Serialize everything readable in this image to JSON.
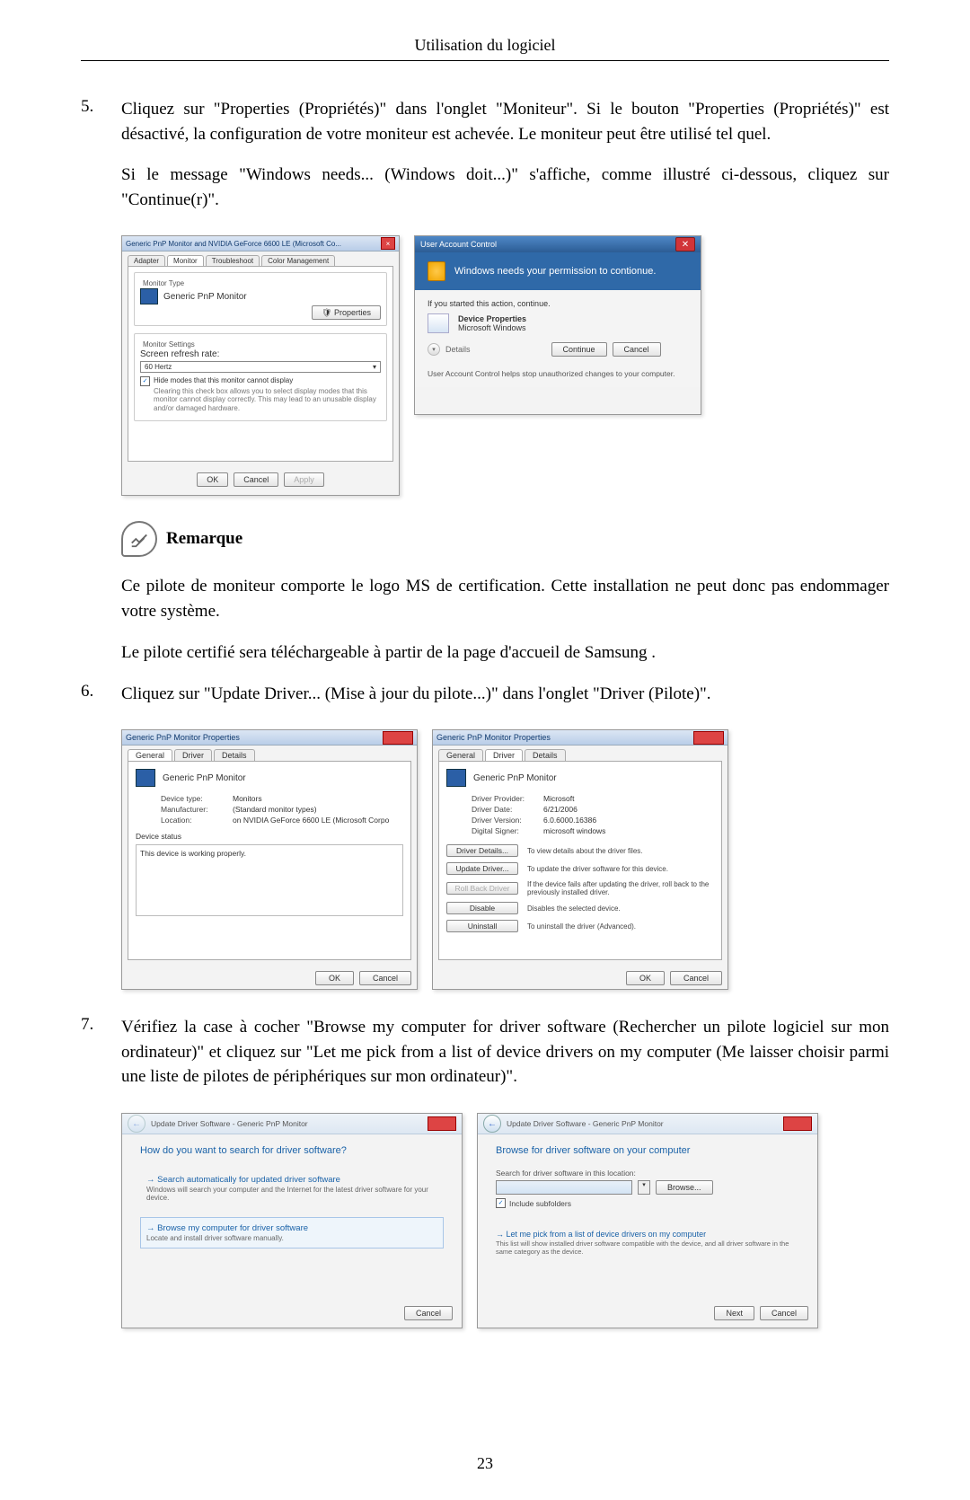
{
  "header": "Utilisation du logiciel",
  "page_number": "23",
  "steps": {
    "s5": {
      "num": "5.",
      "p1": "Cliquez sur \"Properties (Propriétés)\" dans l'onglet \"Moniteur\". Si le bouton \"Properties (Propriétés)\" est désactivé, la configuration de votre moniteur est achevée. Le moniteur peut être utilisé tel quel.",
      "p2": "Si le message \"Windows needs... (Windows doit...)\" s'affiche, comme illustré ci-dessous, cliquez sur \"Continue(r)\"."
    },
    "s6": {
      "num": "6.",
      "p1": "Cliquez sur \"Update Driver... (Mise à jour du pilote...)\" dans l'onglet \"Driver (Pilote)\"."
    },
    "s7": {
      "num": "7.",
      "p1": "Vérifiez la case à cocher \"Browse my computer for driver software (Rechercher un pilote logiciel sur mon ordinateur)\" et cliquez sur \"Let me pick from a list of device drivers on my computer (Me laisser choisir parmi une liste de pilotes de périphériques sur mon ordinateur)\"."
    }
  },
  "remarque": {
    "label": "Remarque",
    "p1": "Ce pilote de moniteur comporte le logo MS de certification. Cette installation ne peut donc pas endommager votre système.",
    "p2": "Le pilote certifié sera téléchargeable à partir de la page d'accueil de Samsung ."
  },
  "d1": {
    "title": "Generic PnP Monitor and NVIDIA GeForce 6600 LE (Microsoft Co...",
    "tabs": {
      "adapter": "Adapter",
      "monitor": "Monitor",
      "trouble": "Troubleshoot",
      "color": "Color Management"
    },
    "monitor_type": "Monitor Type",
    "monitor_name": "Generic PnP Monitor",
    "properties_btn": "Properties",
    "monitor_settings": "Monitor Settings",
    "refresh_label": "Screen refresh rate:",
    "refresh_value": "60 Hertz",
    "hide_modes": "Hide modes that this monitor cannot display",
    "hide_desc": "Clearing this check box allows you to select display modes that this monitor cannot display correctly. This may lead to an unusable display and/or damaged hardware.",
    "ok": "OK",
    "cancel": "Cancel",
    "apply": "Apply"
  },
  "d2": {
    "title": "User Account Control",
    "headline": "Windows needs your permission to contionue.",
    "started": "If you started this action, continue.",
    "app_name": "Device Properties",
    "app_pub": "Microsoft Windows",
    "details": "Details",
    "continue": "Continue",
    "cancel": "Cancel",
    "footer": "User Account Control helps stop unauthorized changes to your computer."
  },
  "d3": {
    "title": "Generic PnP Monitor Properties",
    "tabs": {
      "general": "General",
      "driver": "Driver",
      "details": "Details"
    },
    "name": "Generic PnP Monitor",
    "k_devtype": "Device type:",
    "v_devtype": "Monitors",
    "k_manu": "Manufacturer:",
    "v_manu": "(Standard monitor types)",
    "k_loc": "Location:",
    "v_loc": "on NVIDIA GeForce 6600 LE (Microsoft Corpo",
    "status_label": "Device status",
    "status_text": "This device is working properly.",
    "ok": "OK",
    "cancel": "Cancel"
  },
  "d4": {
    "title": "Generic PnP Monitor Properties",
    "tabs": {
      "general": "General",
      "driver": "Driver",
      "details": "Details"
    },
    "name": "Generic PnP Monitor",
    "k_prov": "Driver Provider:",
    "v_prov": "Microsoft",
    "k_date": "Driver Date:",
    "v_date": "6/21/2006",
    "k_ver": "Driver Version:",
    "v_ver": "6.0.6000.16386",
    "k_sign": "Digital Signer:",
    "v_sign": "microsoft windows",
    "b_details": "Driver Details...",
    "t_details": "To view details about the driver files.",
    "b_update": "Update Driver...",
    "t_update": "To update the driver software for this device.",
    "b_roll": "Roll Back Driver",
    "t_roll": "If the device fails after updating the driver, roll back to the previously installed driver.",
    "b_disable": "Disable",
    "t_disable": "Disables the selected device.",
    "b_uninstall": "Uninstall",
    "t_uninstall": "To uninstall the driver (Advanced).",
    "ok": "OK",
    "cancel": "Cancel"
  },
  "d5": {
    "crumb": "Update Driver Software - Generic PnP Monitor",
    "question": "How do you want to search for driver software?",
    "opt1_t": "Search automatically for updated driver software",
    "opt1_d": "Windows will search your computer and the Internet for the latest driver software for your device.",
    "opt2_t": "Browse my computer for driver software",
    "opt2_d": "Locate and install driver software manually.",
    "cancel": "Cancel"
  },
  "d6": {
    "crumb": "Update Driver Software - Generic PnP Monitor",
    "heading": "Browse for driver software on your computer",
    "search_label": "Search for driver software in this location:",
    "browse": "Browse...",
    "include": "Include subfolders",
    "link": "Let me pick from a list of device drivers on my computer",
    "link_desc": "This list will show installed driver software compatible with the device, and all driver software in the same category as the device.",
    "next": "Next",
    "cancel": "Cancel"
  }
}
